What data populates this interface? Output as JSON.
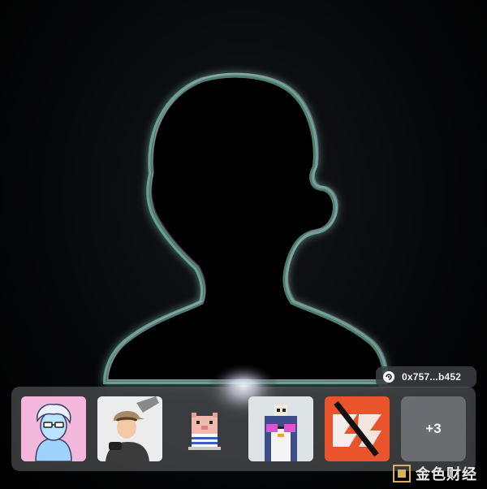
{
  "wallet": {
    "address": "0x757...b452",
    "icon": "wallet-icon"
  },
  "nft_tray": {
    "items": [
      {
        "name": "nft-1",
        "icon": "avatar-glasses-character"
      },
      {
        "name": "nft-2",
        "icon": "avatar-cap-boy"
      },
      {
        "name": "nft-3",
        "icon": "avatar-pixel-pig"
      },
      {
        "name": "nft-4",
        "icon": "avatar-pixel-penguin-skull"
      },
      {
        "name": "nft-5",
        "icon": "avatar-orange-slash"
      }
    ],
    "more_label": "+3"
  },
  "watermark": {
    "text": "金色财经"
  },
  "colors": {
    "glow_green": "#7fe3c0",
    "glow_pink": "#d58ad9",
    "tray_orange": "#e9542d",
    "tray_pink": "#f2b5d9"
  }
}
